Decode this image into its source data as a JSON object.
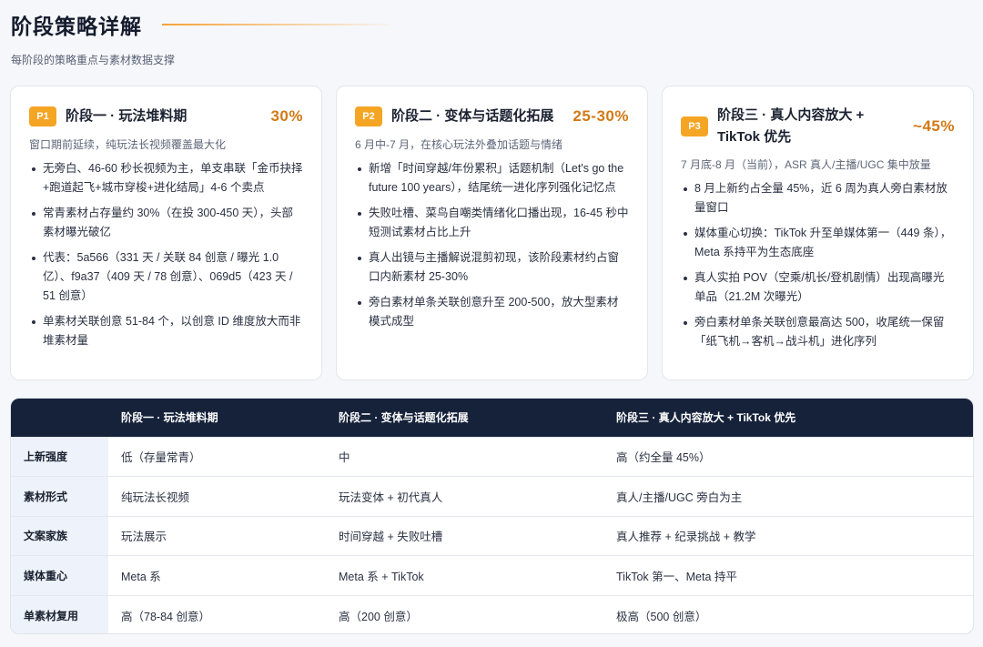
{
  "header": {
    "title": "阶段策略详解",
    "subtitle": "每阶段的策略重点与素材数据支撑"
  },
  "colors": {
    "accent": "#f5a524",
    "percent": "#d27a16",
    "table_header_bg": "#16223a",
    "row_head_bg": "#eef2fa"
  },
  "cards": [
    {
      "badge": "P1",
      "title": "阶段一 · 玩法堆料期",
      "percent": "30%",
      "desc": "窗口期前延续，纯玩法长视频覆盖最大化",
      "bullets": [
        "无旁白、46-60 秒长视频为主，单支串联「金币抉择+跑道起飞+城市穿梭+进化结局」4-6 个卖点",
        "常青素材占存量约 30%（在投 300-450 天），头部素材曝光破亿",
        "代表：5a566（331 天 / 关联 84 创意 / 曝光 1.0 亿）、f9a37（409 天 / 78 创意）、069d5（423 天 / 51 创意）",
        "单素材关联创意 51-84 个，以创意 ID 维度放大而非堆素材量"
      ]
    },
    {
      "badge": "P2",
      "title": "阶段二 · 变体与话题化拓展",
      "percent": "25-30%",
      "desc": "6 月中-7 月，在核心玩法外叠加话题与情绪",
      "bullets": [
        "新增「时间穿越/年份累积」话题机制（Let's go the future 100 years），结尾统一进化序列强化记忆点",
        "失败吐槽、菜鸟自嘲类情绪化口播出现，16-45 秒中短测试素材占比上升",
        "真人出镜与主播解说混剪初现，该阶段素材约占窗口内新素材 25-30%",
        "旁白素材单条关联创意升至 200-500，放大型素材模式成型"
      ]
    },
    {
      "badge": "P3",
      "title": "阶段三 · 真人内容放大 + TikTok 优先",
      "percent": "~45%",
      "desc": "7 月底-8 月（当前），ASR 真人/主播/UGC 集中放量",
      "bullets": [
        "8 月上新约占全量 45%，近 6 周为真人旁白素材放量窗口",
        "媒体重心切换：TikTok 升至单媒体第一（449 条），Meta 系持平为生态底座",
        "真人实拍 POV（空乘/机长/登机剧情）出现高曝光单品（21.2M 次曝光）",
        "旁白素材单条关联创意最高达 500，收尾统一保留「纸飞机→客机→战斗机」进化序列"
      ]
    }
  ],
  "table": {
    "headers": [
      "",
      "阶段一 · 玩法堆料期",
      "阶段二 · 变体与话题化拓展",
      "阶段三 · 真人内容放大 + TikTok 优先"
    ],
    "rows": [
      [
        "上新强度",
        "低（存量常青）",
        "中",
        "高（约全量 45%）"
      ],
      [
        "素材形式",
        "纯玩法长视频",
        "玩法变体 + 初代真人",
        "真人/主播/UGC 旁白为主"
      ],
      [
        "文案家族",
        "玩法展示",
        "时间穿越 + 失败吐槽",
        "真人推荐 + 纪录挑战 + 教学"
      ],
      [
        "媒体重心",
        "Meta 系",
        "Meta 系 + TikTok",
        "TikTok 第一、Meta 持平"
      ],
      [
        "单素材复用",
        "高（78-84 创意）",
        "高（200 创意）",
        "极高（500 创意）"
      ]
    ]
  }
}
